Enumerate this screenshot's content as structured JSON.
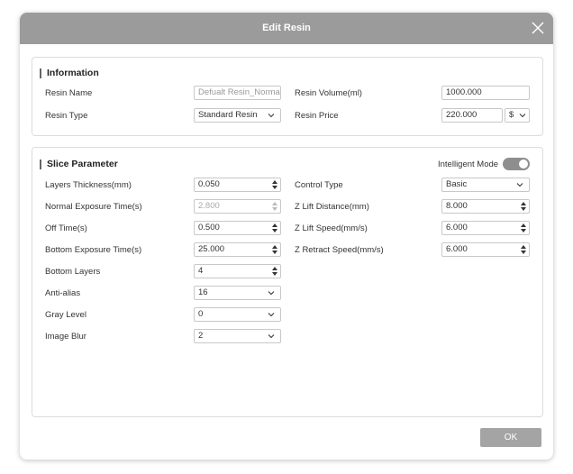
{
  "dialog": {
    "title": "Edit Resin",
    "ok_label": "OK"
  },
  "information": {
    "title": "Information",
    "resin_name_label": "Resin Name",
    "resin_name_placeholder": "Defualt Resin_Normal",
    "resin_type_label": "Resin Type",
    "resin_type_value": "Standard Resin",
    "resin_volume_label": "Resin Volume(ml)",
    "resin_volume_value": "1000.000",
    "resin_price_label": "Resin Price",
    "resin_price_value": "220.000",
    "currency_value": "$"
  },
  "slice": {
    "title": "Slice Parameter",
    "intelligent_mode_label": "Intelligent Mode",
    "intelligent_mode_on": true,
    "layers_thickness_label": "Layers Thickness(mm)",
    "layers_thickness_value": "0.050",
    "normal_exposure_label": "Normal Exposure Time(s)",
    "normal_exposure_value": "2.800",
    "off_time_label": "Off Time(s)",
    "off_time_value": "0.500",
    "bottom_exposure_label": "Bottom Exposure Time(s)",
    "bottom_exposure_value": "25.000",
    "bottom_layers_label": "Bottom Layers",
    "bottom_layers_value": "4",
    "anti_alias_label": "Anti-alias",
    "anti_alias_value": "16",
    "gray_level_label": "Gray Level",
    "gray_level_value": "0",
    "image_blur_label": "Image Blur",
    "image_blur_value": "2",
    "control_type_label": "Control Type",
    "control_type_value": "Basic",
    "z_lift_distance_label": "Z Lift Distance(mm)",
    "z_lift_distance_value": "8.000",
    "z_lift_speed_label": "Z Lift Speed(mm/s)",
    "z_lift_speed_value": "6.000",
    "z_retract_speed_label": "Z Retract Speed(mm/s)",
    "z_retract_speed_value": "6.000"
  },
  "colors": {
    "titlebar": "#9b9b9b",
    "toggle": "#8e8e8e",
    "ok_button": "#a4a4a4"
  }
}
